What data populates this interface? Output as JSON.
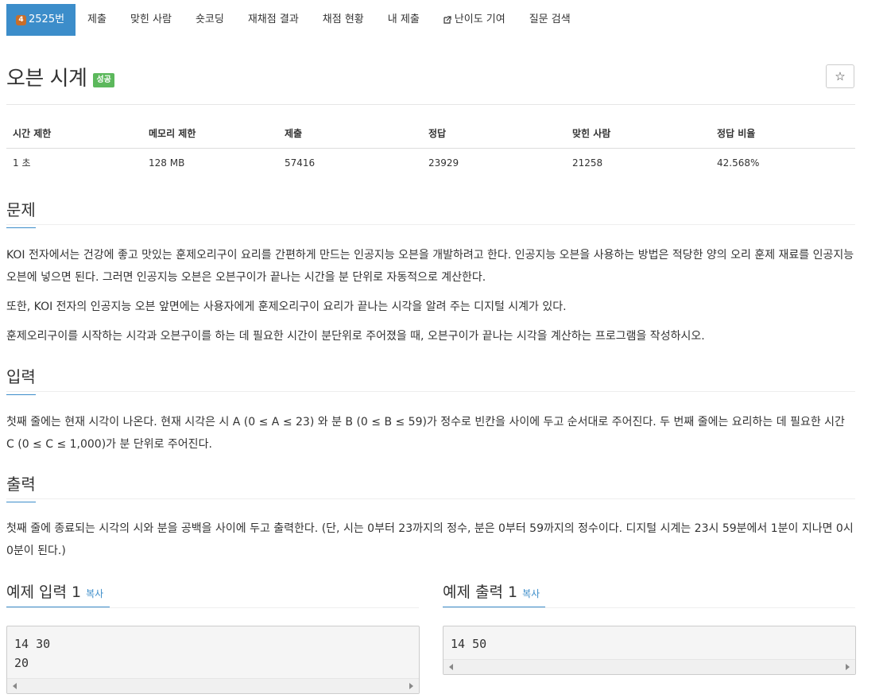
{
  "nav": {
    "problem_tier": "4",
    "problem_number": "2525번",
    "items": [
      "제출",
      "맞힌 사람",
      "숏코딩",
      "재채점 결과",
      "채점 현황",
      "내 제출",
      "난이도 기여",
      "질문 검색"
    ]
  },
  "problem": {
    "title": "오븐 시계",
    "status_badge": "성공",
    "star": "☆"
  },
  "info_table": {
    "headers": [
      "시간 제한",
      "메모리 제한",
      "제출",
      "정답",
      "맞힌 사람",
      "정답 비율"
    ],
    "values": [
      "1 초",
      "128 MB",
      "57416",
      "23929",
      "21258",
      "42.568%"
    ]
  },
  "sections": {
    "description_title": "문제",
    "description": [
      "KOI 전자에서는 건강에 좋고 맛있는 훈제오리구이 요리를 간편하게 만드는 인공지능 오븐을 개발하려고 한다. 인공지능 오븐을 사용하는 방법은 적당한 양의 오리 훈제 재료를 인공지능 오븐에 넣으면 된다. 그러면 인공지능 오븐은 오븐구이가 끝나는 시간을 분 단위로 자동적으로 계산한다.",
      "또한, KOI 전자의 인공지능 오븐 앞면에는 사용자에게 훈제오리구이 요리가 끝나는 시각을 알려 주는 디지털 시계가 있다.",
      "훈제오리구이를 시작하는 시각과 오븐구이를 하는 데 필요한 시간이 분단위로 주어졌을 때, 오븐구이가 끝나는 시각을 계산하는 프로그램을 작성하시오."
    ],
    "input_title": "입력",
    "input": "첫째 줄에는 현재 시각이 나온다. 현재 시각은 시 A (0 ≤ A ≤ 23) 와 분 B (0 ≤ B ≤ 59)가 정수로 빈칸을 사이에 두고 순서대로 주어진다. 두 번째 줄에는 요리하는 데 필요한 시간 C (0 ≤ C ≤ 1,000)가 분 단위로 주어진다.",
    "output_title": "출력",
    "output": "첫째 줄에 종료되는 시각의 시와 분을 공백을 사이에 두고 출력한다. (단, 시는 0부터 23까지의 정수, 분은 0부터 59까지의 정수이다. 디지털 시계는 23시 59분에서 1분이 지나면 0시 0분이 된다.)"
  },
  "samples": {
    "input_title": "예제 입력 1",
    "output_title": "예제 출력 1",
    "copy_label": "복사",
    "input_text": "14 30\n20",
    "output_text": "14 50"
  }
}
